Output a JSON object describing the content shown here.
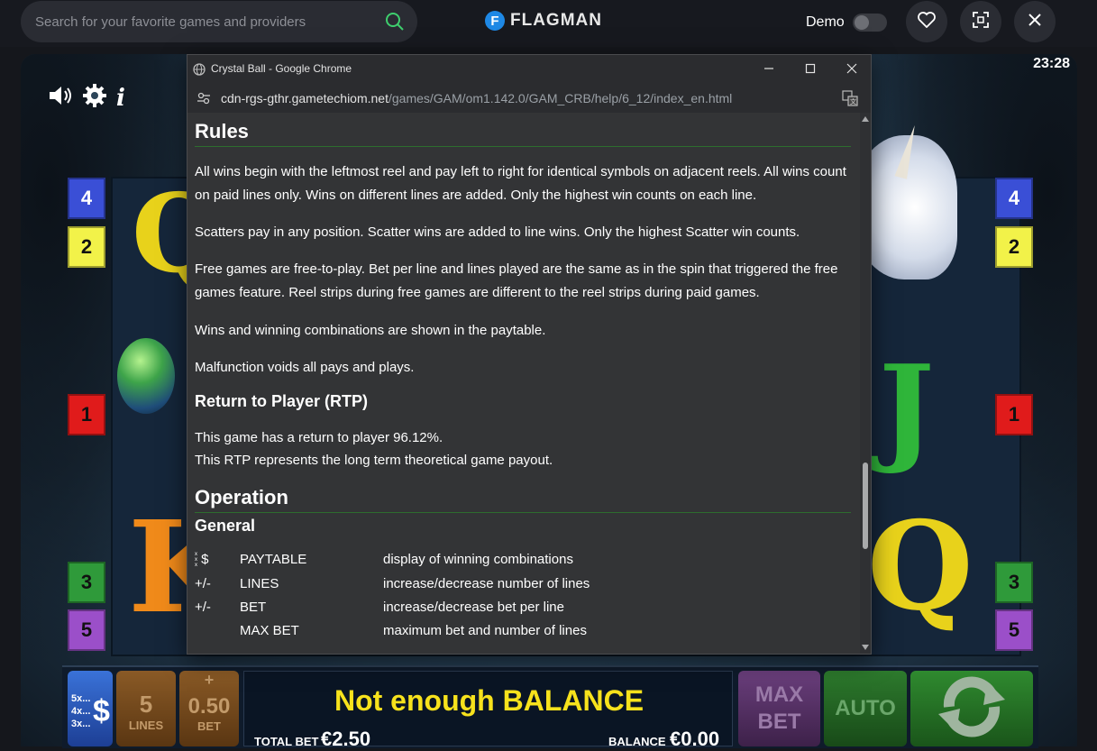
{
  "topbar": {
    "search_placeholder": "Search for your favorite games and providers",
    "logo_letter": "F",
    "logo_text": "FLAGMAN",
    "demo_label": "Demo"
  },
  "game": {
    "clock": "23:28",
    "line_badges_left": [
      "4",
      "2",
      "1",
      "3",
      "5"
    ],
    "line_badges_right": [
      "4",
      "2",
      "1",
      "3",
      "5"
    ],
    "symbols": {
      "q_top": "Q",
      "k": "K",
      "j": "J",
      "q_right": "Q"
    },
    "bottom": {
      "paytable_multipliers": [
        "5x...",
        "4x...",
        "3x..."
      ],
      "paytable_symbol": "$",
      "lines_value": "5",
      "lines_label": "LINES",
      "bet_value": "0.50",
      "bet_label": "BET",
      "bet_plus": "+",
      "message": "Not enough BALANCE",
      "total_bet_label": "TOTAL BET",
      "total_bet_value": "€2.50",
      "balance_label": "BALANCE",
      "balance_value": "€0.00",
      "max_bet_line1": "MAX",
      "max_bet_line2": "BET",
      "auto_label": "AUTO"
    }
  },
  "browser": {
    "window_title": "Crystal Ball - Google Chrome",
    "url_host": "cdn-rgs-gthr.gametechiom.net",
    "url_path": "/games/GAM/om1.142.0/GAM_CRB/help/6_12/index_en.html",
    "help": {
      "rules_heading": "Rules",
      "rules_paragraphs": [
        "All wins begin with the leftmost reel and pay left to right for identical symbols on adjacent reels. All wins count on paid lines only. Wins on different lines are added. Only the highest win counts on each line.",
        "Scatters pay in any position. Scatter wins are added to line wins. Only the highest Scatter win counts.",
        "Free games are free-to-play. Bet per line and lines played are the same as in the spin that triggered the free games feature. Reel strips during free games are different to the reel strips during paid games.",
        "Wins and winning combinations are shown in the paytable.",
        "Malfunction voids all pays and plays."
      ],
      "rtp_heading": "Return to Player (RTP)",
      "rtp_line1": "This game has a return to player 96.12%.",
      "rtp_line2": "This RTP represents the long term theoretical game payout.",
      "operation_heading": "Operation",
      "general_heading": "General",
      "table": [
        {
          "icon": "$",
          "name": "PAYTABLE",
          "desc": "display of winning combinations"
        },
        {
          "icon": "+/-",
          "name": "LINES",
          "desc": "increase/decrease number of lines"
        },
        {
          "icon": "+/-",
          "name": "BET",
          "desc": "increase/decrease bet per line"
        },
        {
          "icon": "",
          "name": "MAX BET",
          "desc": "maximum bet and number of lines"
        }
      ]
    }
  },
  "colors": {
    "accent_yellow": "#f7e21c",
    "heading_rule": "#2e6d2e",
    "badge_blue": "#3a4fd6",
    "badge_yellow": "#f2f249",
    "badge_red": "#e01b1b",
    "badge_green": "#2f9a3a",
    "badge_purple": "#9b4fc9"
  }
}
